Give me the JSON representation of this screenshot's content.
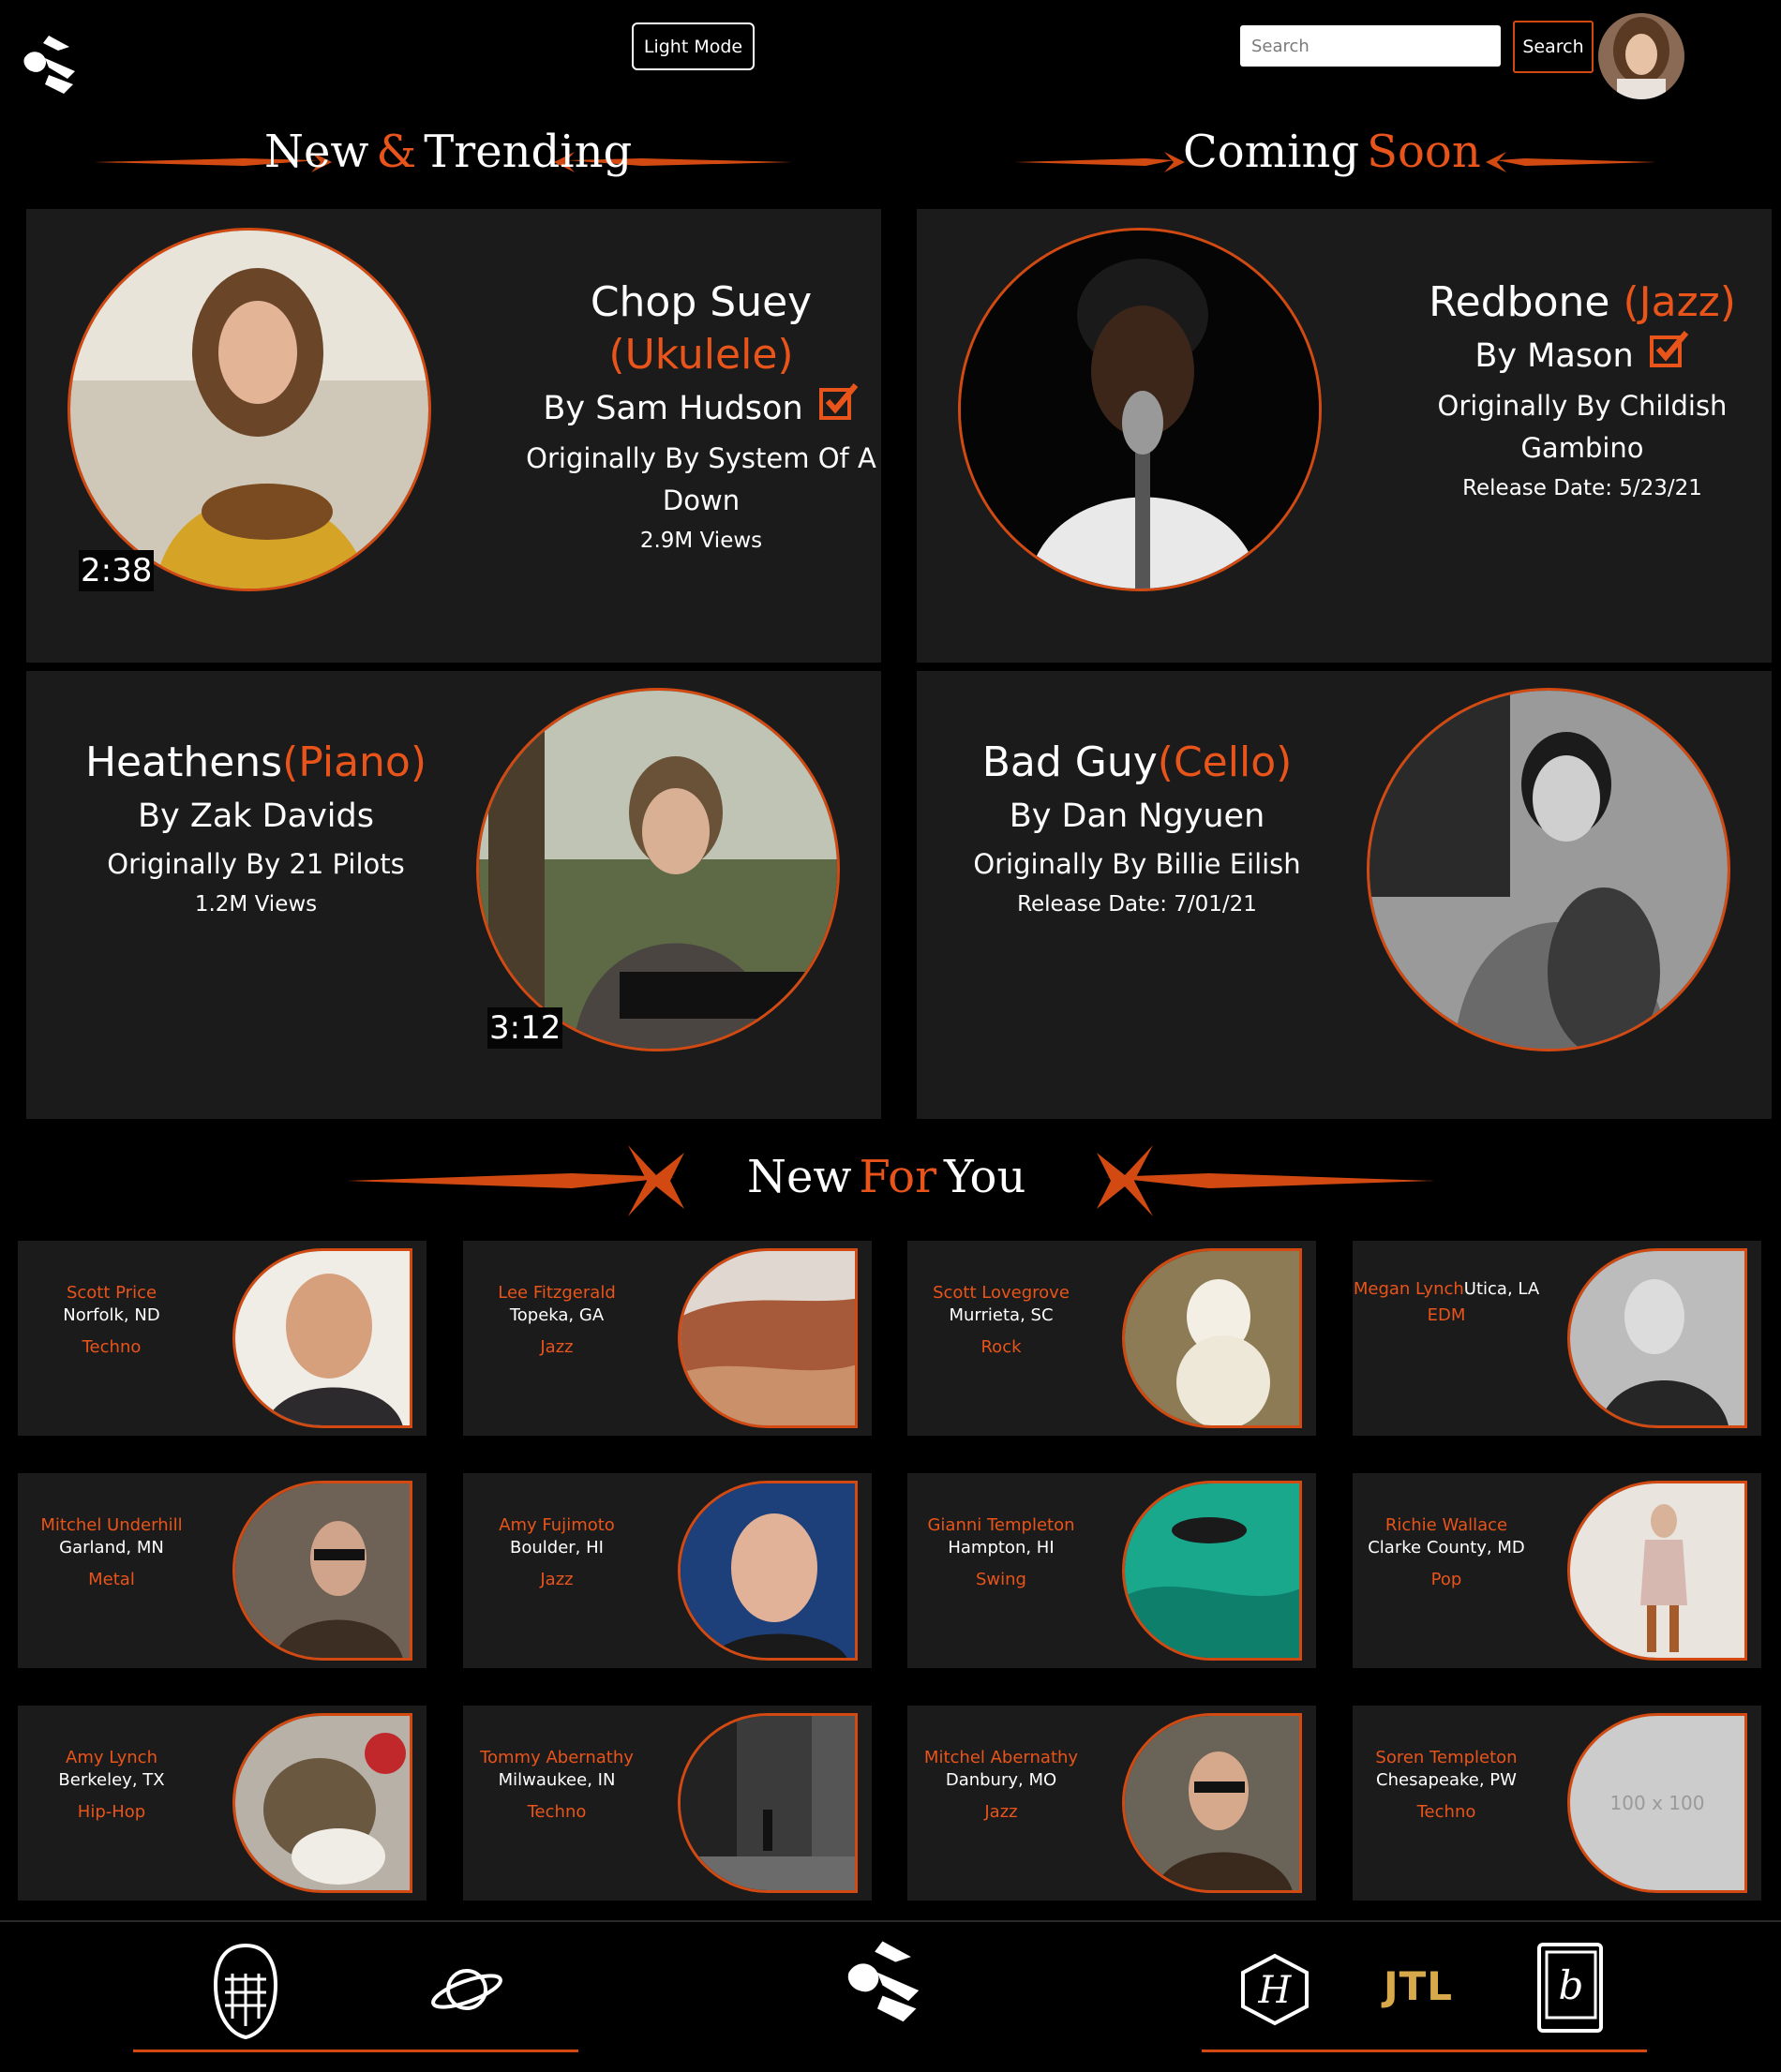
{
  "header": {
    "light_mode_label": "Light Mode",
    "search_placeholder": "Search",
    "search_button_label": "Search"
  },
  "sections": {
    "trending": {
      "word1": "New",
      "amp": "&",
      "word2": "Trending"
    },
    "coming": {
      "word1": "Coming",
      "word2": "Soon"
    },
    "for_you": {
      "word1": "New",
      "word2": "For",
      "word3": "You"
    }
  },
  "featured": [
    {
      "title": "Chop Suey",
      "instrument": "(Ukulele)",
      "by": "By Sam Hudson",
      "original": "Originally By System Of A Down",
      "meta": "2.9M Views",
      "duration": "2:38"
    },
    {
      "title": "Redbone",
      "instrument": "(Jazz)",
      "by": "By Mason",
      "original": "Originally By Childish Gambino",
      "meta": "Release Date: 5/23/21"
    },
    {
      "title": "Heathens",
      "instrument": "(Piano)",
      "by": "By Zak Davids",
      "original": "Originally By 21 Pilots",
      "meta": "1.2M Views",
      "duration": "3:12"
    },
    {
      "title": "Bad Guy",
      "instrument": "(Cello)",
      "by": "By Dan Ngyuen",
      "original": "Originally By Billie Eilish",
      "meta": "Release Date: 7/01/21"
    }
  ],
  "for_you": [
    {
      "name": "Scott Price",
      "location": "Norfolk, ND",
      "genre": "Techno"
    },
    {
      "name": "Lee Fitzgerald",
      "location": "Topeka, GA",
      "genre": "Jazz"
    },
    {
      "name": "Scott Lovegrove",
      "location": "Murrieta, SC",
      "genre": "Rock"
    },
    {
      "name": "Megan Lynch",
      "location": "Utica, LA",
      "genre": "EDM"
    },
    {
      "name": "Mitchel Underhill",
      "location": "Garland, MN",
      "genre": "Metal"
    },
    {
      "name": "Amy Fujimoto",
      "location": "Boulder, HI",
      "genre": "Jazz"
    },
    {
      "name": "Gianni Templeton",
      "location": "Hampton, HI",
      "genre": "Swing"
    },
    {
      "name": "Richie Wallace",
      "location": "Clarke County, MD",
      "genre": "Pop"
    },
    {
      "name": "Amy Lynch",
      "location": "Berkeley, TX",
      "genre": "Hip-Hop"
    },
    {
      "name": "Tommy Abernathy",
      "location": "Milwaukee, IN",
      "genre": "Techno"
    },
    {
      "name": "Mitchel Abernathy",
      "location": "Danbury, MO",
      "genre": "Jazz"
    },
    {
      "name": "Soren Templeton",
      "location": "Chesapeake, PW",
      "genre": "Techno"
    }
  ],
  "placeholder_image_text": "100 x 100",
  "footer": {
    "jtl_label": "JTL",
    "h_label": "H",
    "b_label": "b"
  },
  "colors": {
    "accent": "#e8541a",
    "card_bg": "#1b1b1b",
    "background": "#000000"
  }
}
